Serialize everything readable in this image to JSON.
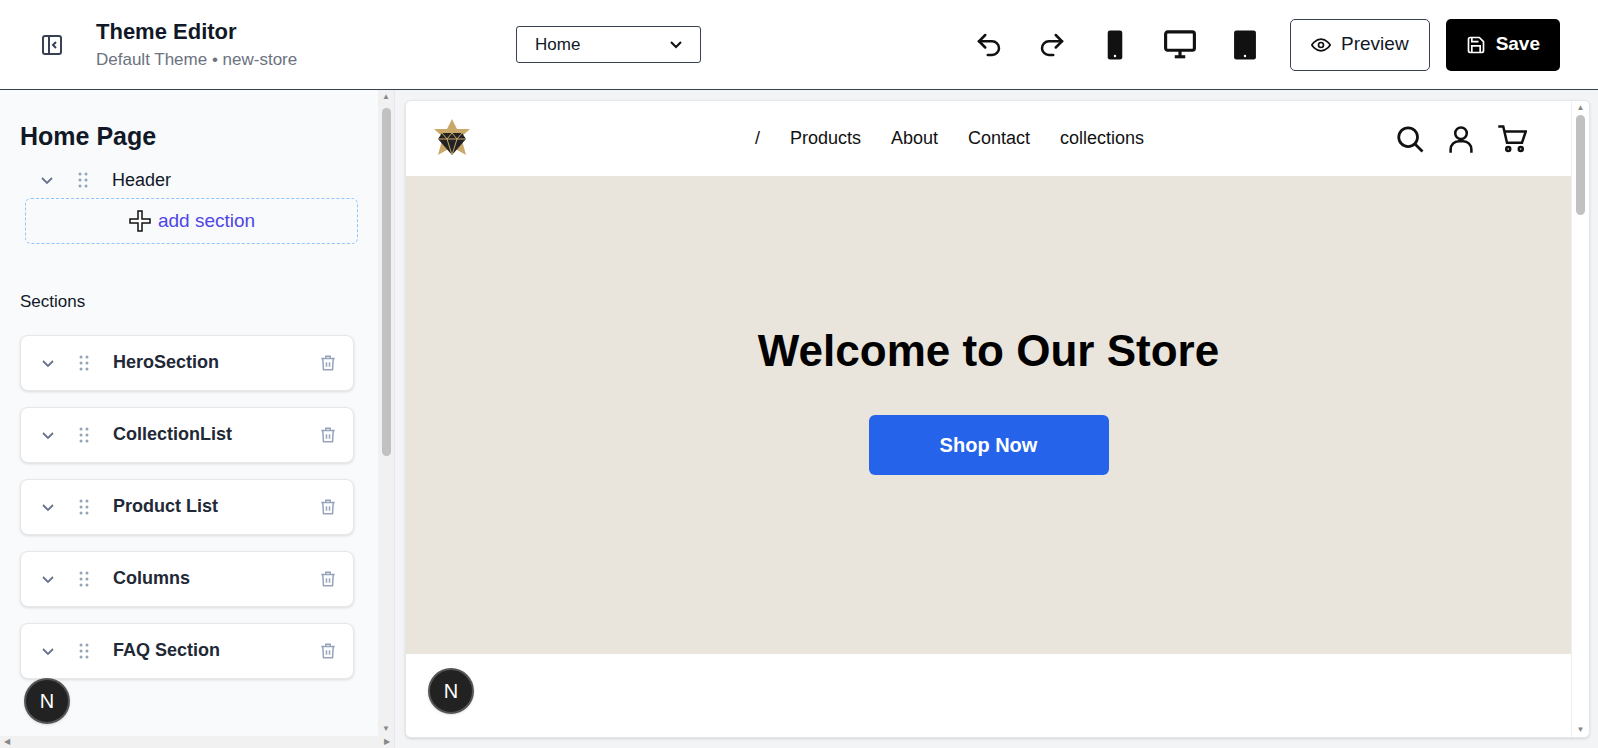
{
  "header": {
    "title": "Theme Editor",
    "subtitle": "Default Theme • new-store",
    "page_select": "Home",
    "preview": "Preview",
    "save": "Save"
  },
  "sidebar": {
    "title": "Home Page",
    "header_item": {
      "label": "Header",
      "expanded": false
    },
    "add_section": "add section",
    "sections_label": "Sections",
    "sections": [
      {
        "label": "HeroSection",
        "expanded": false
      },
      {
        "label": "CollectionList",
        "expanded": false
      },
      {
        "label": "Product List",
        "expanded": false
      },
      {
        "label": "Columns",
        "expanded": false
      },
      {
        "label": "FAQ Section",
        "expanded": false
      }
    ]
  },
  "preview": {
    "nav": [
      "/",
      "Products",
      "About",
      "Contact",
      "collections"
    ],
    "hero": {
      "title": "Welcome to Our Store",
      "button": "Shop Now"
    }
  },
  "badges": [
    "N",
    "N"
  ]
}
